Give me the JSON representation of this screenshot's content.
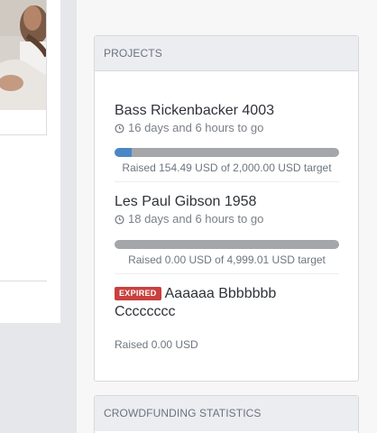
{
  "sidebar": {
    "projects_heading": "PROJECTS",
    "stats_heading": "CROWDFUNDING STATISTICS"
  },
  "projects": [
    {
      "title": "Bass Rickenbacker 4003",
      "time_left": "16 days and 6 hours to go",
      "progress_fraction": 0.077,
      "raised": "Raised 154.49 USD of 2,000.00 USD target",
      "icon": "clock-icon"
    },
    {
      "title": "Les Paul Gibson 1958",
      "time_left": "18 days and 6 hours to go",
      "progress_fraction": 0.0,
      "raised": "Raised 0.00 USD of 4,999.01 USD target",
      "icon": "clock-icon"
    },
    {
      "badge": "EXPIRED",
      "title_line1": "Aaaaaa Bbbbbbb",
      "title_line2": "Cccccccc",
      "raised": "Raised 0.00 USD"
    }
  ],
  "colors": {
    "progress_fill": "#4a88c5",
    "progress_track": "#a4a6aa",
    "expired_badge": "#c9403e"
  }
}
